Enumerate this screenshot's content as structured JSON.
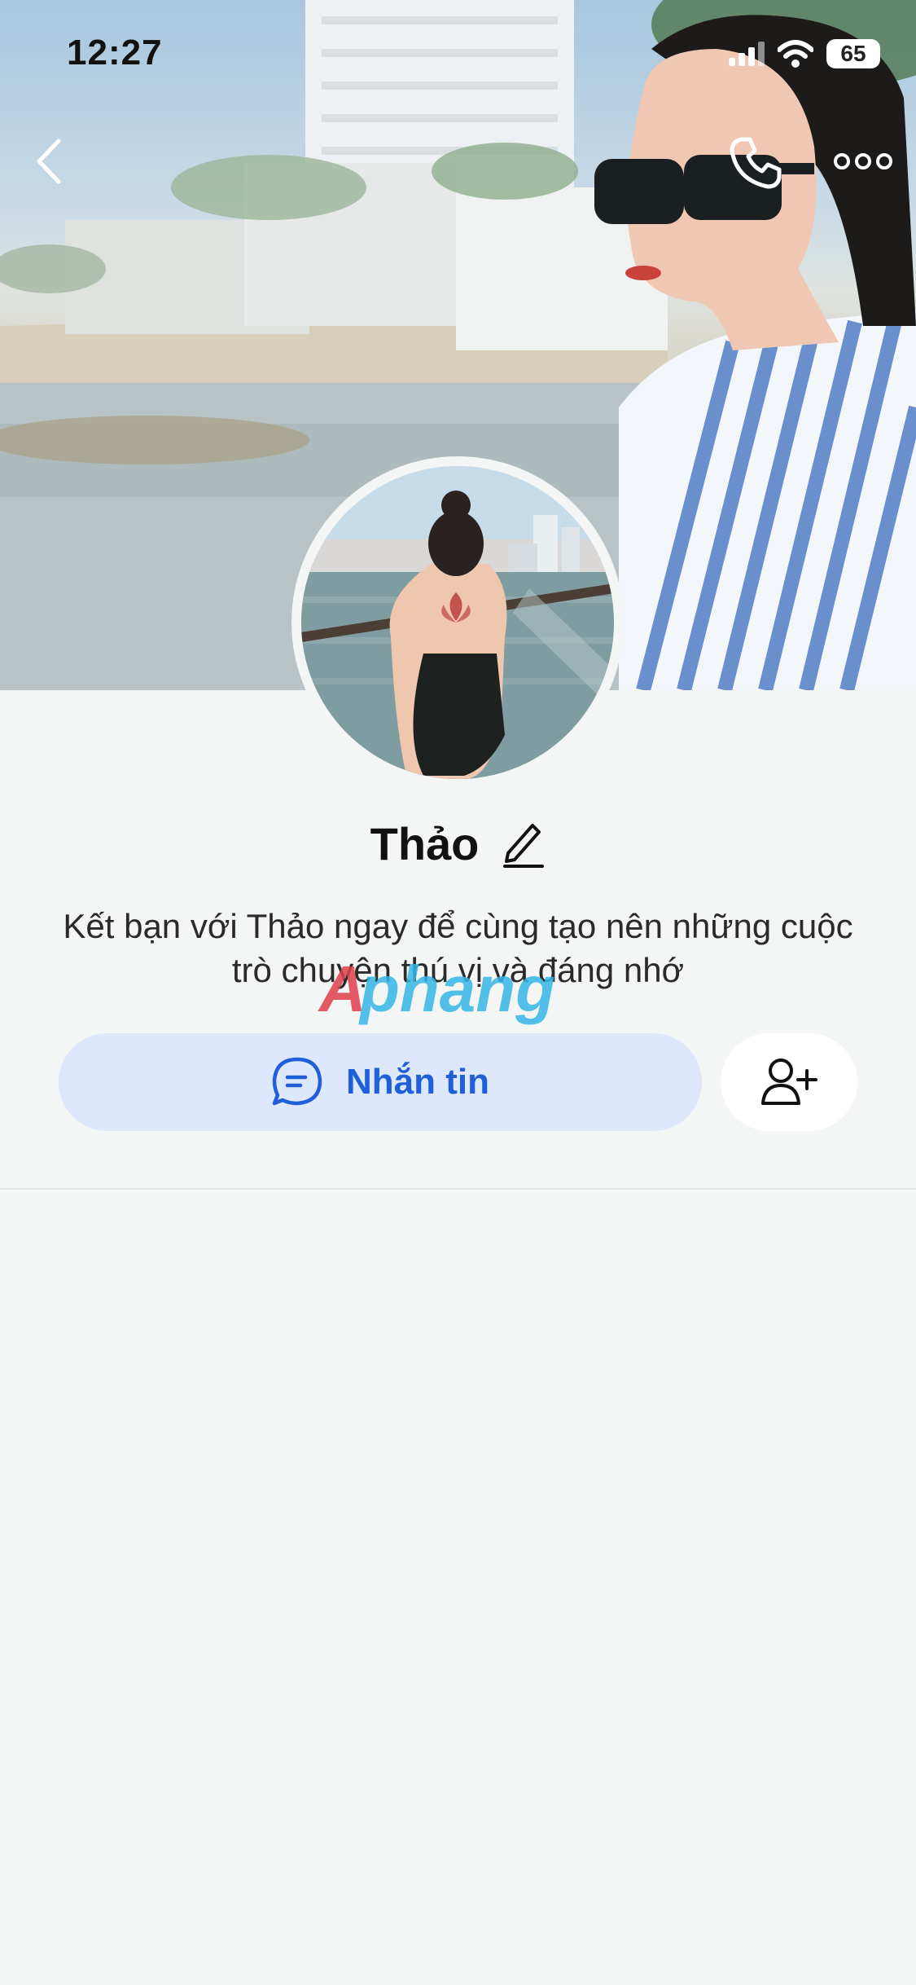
{
  "status_bar": {
    "time": "12:27",
    "battery": "65",
    "icons": [
      "signal-icon",
      "wifi-icon",
      "battery-icon"
    ]
  },
  "nav": {
    "icons": [
      "back-icon",
      "phone-icon",
      "more-icon"
    ]
  },
  "profile": {
    "name": "Thảo",
    "description": "Kết bạn với Thảo ngay để cùng tạo nên những cuộc trò chuyện thú vị và đáng nhớ"
  },
  "actions": {
    "message_label": "Nhắn tin",
    "message_icon": "chat-icon",
    "add_friend_icon": "add-friend-icon"
  },
  "watermark": {
    "text": "Aphang"
  },
  "colors": {
    "accent": "#1f5fd9",
    "message_button_bg": "#dde8fc",
    "background": "#f4f5f5"
  }
}
